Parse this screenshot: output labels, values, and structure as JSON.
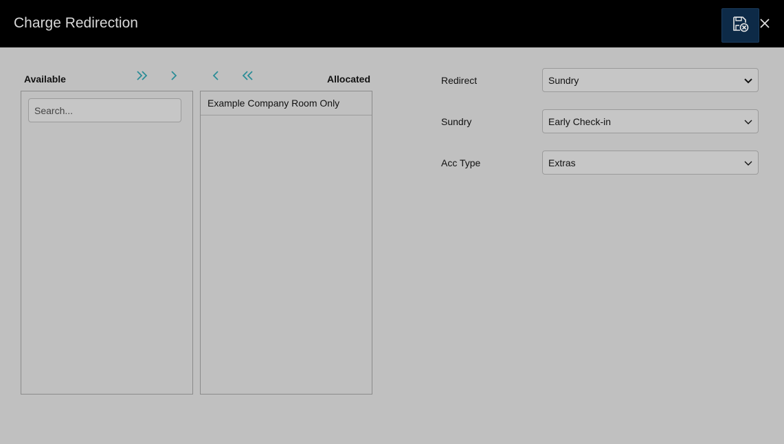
{
  "header": {
    "title": "Charge Redirection",
    "save_icon": "save-cancel-icon",
    "close_icon": "close-icon"
  },
  "available": {
    "label": "Available",
    "search_placeholder": "Search...",
    "items": []
  },
  "allocated": {
    "label": "Allocated",
    "items": [
      "Example Company Room Only"
    ]
  },
  "transfer": {
    "move_all_right_icon": "double-chevron-right-icon",
    "move_right_icon": "chevron-right-icon",
    "move_left_icon": "chevron-left-icon",
    "move_all_left_icon": "double-chevron-left-icon"
  },
  "form": {
    "redirect": {
      "label": "Redirect",
      "value": "Sundry"
    },
    "sundry": {
      "label": "Sundry",
      "value": "Early Check-in"
    },
    "acc_type": {
      "label": "Acc Type",
      "value": "Extras"
    }
  },
  "colors": {
    "background": "#c0c0c0",
    "header": "#000000",
    "accent": "#2a8c96",
    "save_button": "#0d2a47"
  }
}
